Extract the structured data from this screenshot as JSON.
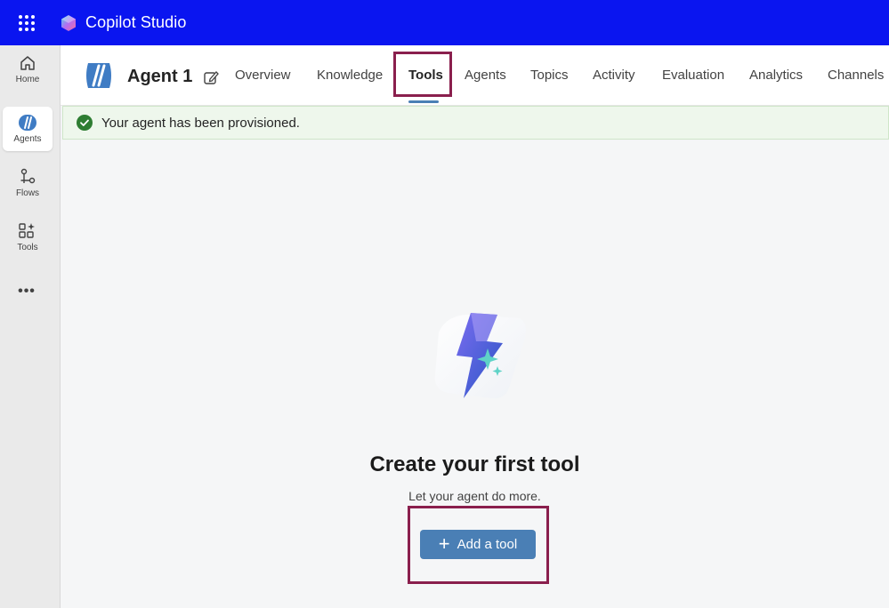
{
  "app": {
    "title": "Copilot Studio"
  },
  "rail": {
    "items": [
      {
        "label": "Home",
        "icon": "home-icon"
      },
      {
        "label": "Agents",
        "icon": "agents-icon"
      },
      {
        "label": "Flows",
        "icon": "flows-icon"
      },
      {
        "label": "Tools",
        "icon": "tools-icon"
      }
    ],
    "more": "•••"
  },
  "header": {
    "agent_name": "Agent 1",
    "tabs": [
      {
        "label": "Overview"
      },
      {
        "label": "Knowledge"
      },
      {
        "label": "Tools",
        "selected": true
      },
      {
        "label": "Agents"
      },
      {
        "label": "Topics"
      },
      {
        "label": "Activity"
      },
      {
        "label": "Evaluation"
      },
      {
        "label": "Analytics"
      },
      {
        "label": "Channels"
      }
    ]
  },
  "banner": {
    "message": "Your agent has been provisioned."
  },
  "empty_state": {
    "title": "Create your first tool",
    "subtitle": "Let your agent do more.",
    "button_label": "Add a tool",
    "button_icon": "plus-icon"
  },
  "colors": {
    "topbar": "#0a15f0",
    "accent": "#4a7fb5",
    "highlight": "#8a1f4d",
    "success": "#2e7d32"
  }
}
